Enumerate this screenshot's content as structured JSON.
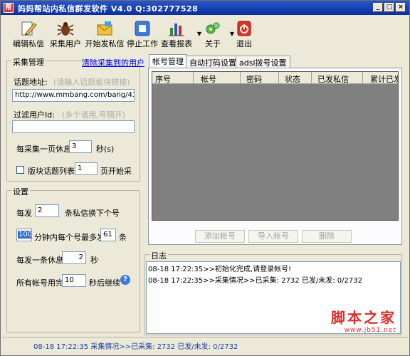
{
  "window": {
    "title": "妈妈帮站内私信群发软件 V4.0 Q:302777528",
    "icon_char": "帮"
  },
  "toolbar": {
    "items": [
      {
        "label": "编辑私信",
        "icon": "pencil-icon"
      },
      {
        "label": "采集用户",
        "icon": "bug-icon"
      },
      {
        "label": "开始发私信",
        "icon": "mail-icon"
      },
      {
        "label": "停止工作",
        "icon": "stop-icon"
      },
      {
        "label": "查看报表",
        "icon": "chart-icon"
      },
      {
        "label": "关于",
        "icon": "gears-icon"
      },
      {
        "label": "退出",
        "icon": "exit-icon"
      }
    ]
  },
  "collect": {
    "legend": "采集管理",
    "clear_link": "清除采集到的用户",
    "topic_label": "话题地址:",
    "topic_hint": "(请输入话题板块链接)",
    "topic_value": "http://www.mmbang.com/bang/436",
    "filter_label": "过滤用户Id:",
    "filter_hint": "(多个请用,号隔开)",
    "filter_value": "",
    "rest_prefix": "每采集一页休息",
    "rest_value": "3",
    "rest_suffix": "秒(s)",
    "block_check_label": "版块话题列表第",
    "block_page_value": "1",
    "block_suffix": "页开始采"
  },
  "settings": {
    "legend": "设置",
    "per_send_prefix": "每发",
    "per_send_value": "2",
    "per_send_suffix": "条私信换下个号",
    "minutes_value": "100",
    "minutes_mid": "分钟内每个号最多发",
    "max_value": "61",
    "max_suffix": "条",
    "rest_prefix": "每发一条休息",
    "rest_value": "2",
    "rest_suffix": "秒",
    "cycle_prefix": "所有帐号用完",
    "cycle_value": "10",
    "cycle_suffix": "秒后继续",
    "help_icon": "help-icon"
  },
  "tabs": [
    {
      "label": "帐号管理",
      "active": true
    },
    {
      "label": "自动打码设置",
      "active": false
    },
    {
      "label": "adsl拨号设置",
      "active": false
    }
  ],
  "grid": {
    "columns": [
      "序号",
      "帐号",
      "密码",
      "状态",
      "已发私信",
      "累计已发"
    ]
  },
  "grid_buttons": {
    "add": "添加帐号",
    "import": "导入帐号",
    "delete": "删除"
  },
  "log": {
    "legend": "日志",
    "lines": [
      "08-18 17:22:35>>初始化完成,请登录帐号!",
      "08-18 17:22:35>>采集情况>>已采集: 2732 已发/未发: 0/2732"
    ]
  },
  "status": {
    "text": "08-18 17:22:35 采集情况>>已采集: 2732 已发/未发: 0/2732"
  },
  "watermark": {
    "title": "脚本之家",
    "url": "www.jb51.net"
  },
  "colors": {
    "titlebar": "#0a2f9e",
    "grid_bg": "#808080",
    "status_text": "#1a3fa8",
    "link": "#0000ff",
    "watermark": "#d9302c"
  }
}
